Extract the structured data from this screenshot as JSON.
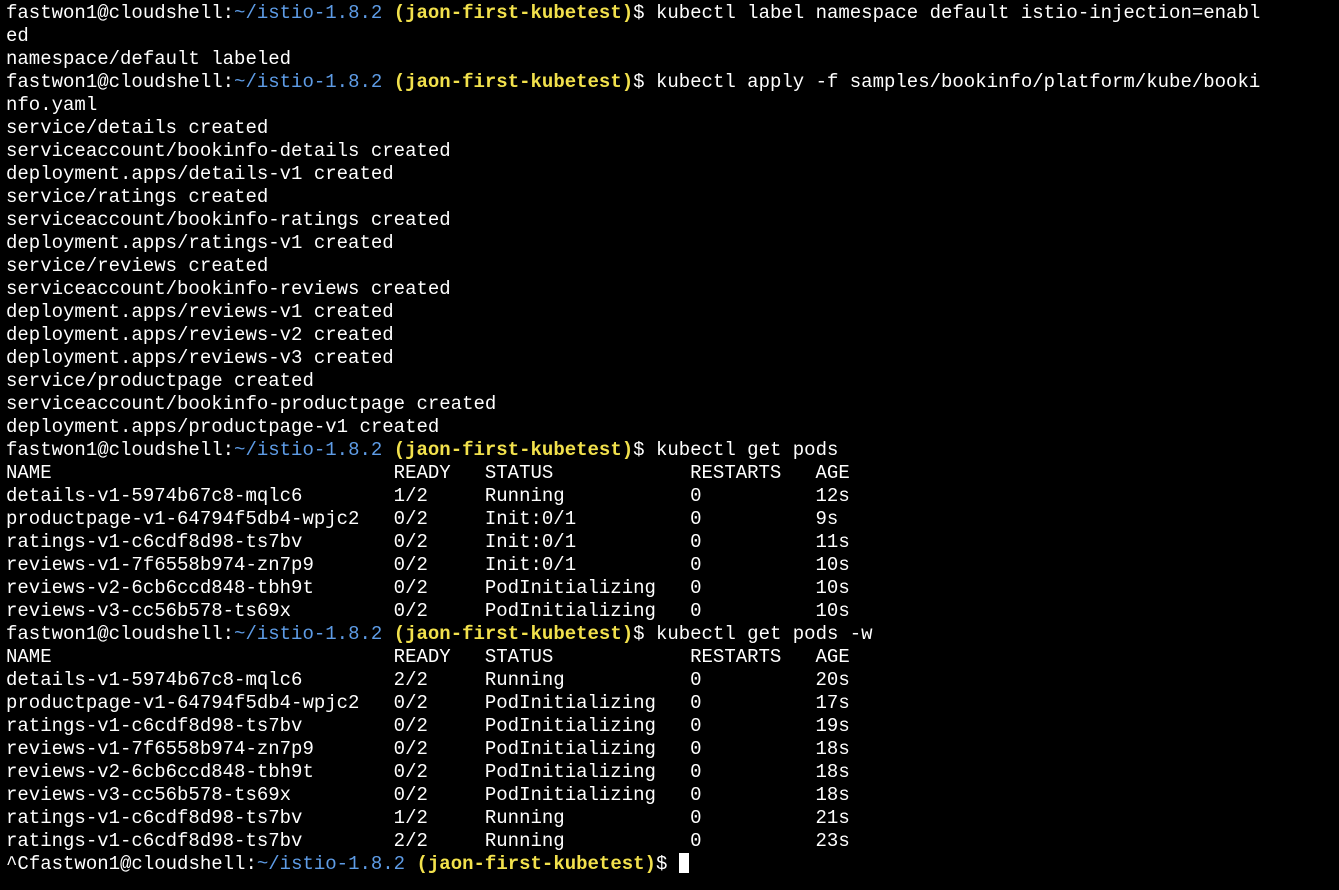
{
  "colors": {
    "background": "#000000",
    "text": "#ffffff",
    "path": "#5e9ce6",
    "project": "#f2e14c"
  },
  "prompt": {
    "user_host": "fastwon1@cloudshell:",
    "path": "~/istio-1.8.2",
    "project": "(jaon-first-kubetest)",
    "symbol": "$"
  },
  "cmd1": {
    "command": "kubectl label namespace default istio-injection=enabl",
    "wrap": "ed",
    "output": [
      "namespace/default labeled"
    ]
  },
  "cmd2": {
    "command": "kubectl apply -f samples/bookinfo/platform/kube/booki",
    "wrap": "nfo.yaml",
    "output": [
      "service/details created",
      "serviceaccount/bookinfo-details created",
      "deployment.apps/details-v1 created",
      "service/ratings created",
      "serviceaccount/bookinfo-ratings created",
      "deployment.apps/ratings-v1 created",
      "service/reviews created",
      "serviceaccount/bookinfo-reviews created",
      "deployment.apps/reviews-v1 created",
      "deployment.apps/reviews-v2 created",
      "deployment.apps/reviews-v3 created",
      "service/productpage created",
      "serviceaccount/bookinfo-productpage created",
      "deployment.apps/productpage-v1 created"
    ]
  },
  "cmd3": {
    "command": "kubectl get pods",
    "lines": [
      "NAME                              READY   STATUS            RESTARTS   AGE",
      "details-v1-5974b67c8-mqlc6        1/2     Running           0          12s",
      "productpage-v1-64794f5db4-wpjc2   0/2     Init:0/1          0          9s",
      "ratings-v1-c6cdf8d98-ts7bv        0/2     Init:0/1          0          11s",
      "reviews-v1-7f6558b974-zn7p9       0/2     Init:0/1          0          10s",
      "reviews-v2-6cb6ccd848-tbh9t       0/2     PodInitializing   0          10s",
      "reviews-v3-cc56b578-ts69x         0/2     PodInitializing   0          10s"
    ]
  },
  "cmd4": {
    "command": "kubectl get pods -w",
    "lines": [
      "NAME                              READY   STATUS            RESTARTS   AGE",
      "details-v1-5974b67c8-mqlc6        2/2     Running           0          20s",
      "productpage-v1-64794f5db4-wpjc2   0/2     PodInitializing   0          17s",
      "ratings-v1-c6cdf8d98-ts7bv        0/2     PodInitializing   0          19s",
      "reviews-v1-7f6558b974-zn7p9       0/2     PodInitializing   0          18s",
      "reviews-v2-6cb6ccd848-tbh9t       0/2     PodInitializing   0          18s",
      "reviews-v3-cc56b578-ts69x         0/2     PodInitializing   0          18s",
      "ratings-v1-c6cdf8d98-ts7bv        1/2     Running           0          21s",
      "ratings-v1-c6cdf8d98-ts7bv        2/2     Running           0          23s"
    ]
  },
  "final": {
    "prefix": "^C"
  }
}
